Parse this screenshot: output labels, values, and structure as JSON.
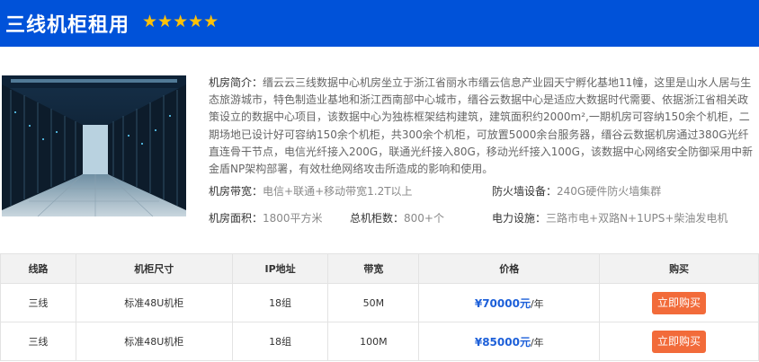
{
  "header": {
    "title": "三线机柜租用",
    "stars": "★★★★★"
  },
  "info": {
    "intro_label": "机房简介：",
    "intro_text": "缙云云三线数据中心机房坐立于浙江省丽水市缙云信息产业园天宁孵化基地11幢，这里是山水人居与生态旅游城市，特色制造业基地和浙江西南部中心城市，缙谷云数据中心是适应大数据时代需要、依据浙江省相关政策设立的数据中心项目，该数据中心为独栋框架结构建筑，建筑面积约2000m²,一期机房可容纳150余个机柜，二期场地已设计好可容纳150余个机柜，共300余个机柜，可放置5000余台服务器，缙谷云数据机房通过380G光纤直连骨干节点，电信光纤接入200G，联通光纤接入80G，移动光纤接入100G，该数据中心网络安全防御采用中新金盾NP架构部署，有效杜绝网络攻击所造成的影响和使用。"
  },
  "specs": {
    "bandwidth_label": "机房带宽：",
    "bandwidth_value": "电信+联通+移动带宽1.2T以上",
    "firewall_label": "防火墙设备：",
    "firewall_value": "240G硬件防火墙集群",
    "area_label": "机房面积：",
    "area_value": "1800平方米",
    "racks_label": "总机柜数：",
    "racks_value": "800+个",
    "power_label": "电力设施：",
    "power_value": "三路市电+双路N+1UPS+柴油发电机"
  },
  "table": {
    "headers": [
      "线路",
      "机柜尺寸",
      "IP地址",
      "带宽",
      "价格",
      "购买"
    ],
    "rows": [
      {
        "line": "三线",
        "size": "标准48U机柜",
        "ip": "18组",
        "bandwidth": "50M",
        "price": "¥70000元",
        "unit": "/年",
        "buy": "立即购买"
      },
      {
        "line": "三线",
        "size": "标准48U机柜",
        "ip": "18组",
        "bandwidth": "100M",
        "price": "¥85000元",
        "unit": "/年",
        "buy": "立即购买"
      }
    ]
  },
  "colors": {
    "header_bg": "#0052d9",
    "stars": "#ffc107",
    "price": "#1c5fd9",
    "buy_button": "#f26b3a"
  },
  "icons": {
    "stars": "star-icon",
    "photo": "server-room-photo"
  }
}
